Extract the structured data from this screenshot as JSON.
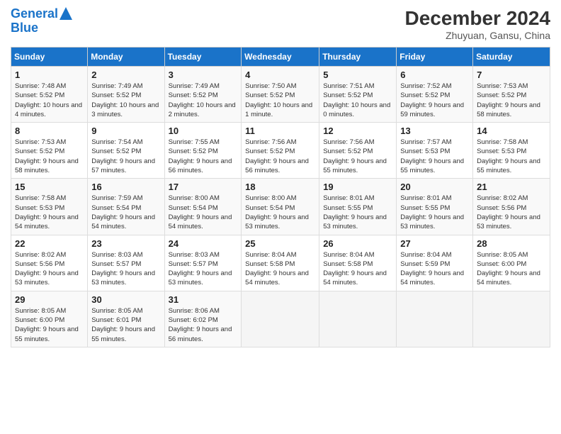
{
  "header": {
    "logo_line1": "General",
    "logo_line2": "Blue",
    "month": "December 2024",
    "location": "Zhuyuan, Gansu, China"
  },
  "weekdays": [
    "Sunday",
    "Monday",
    "Tuesday",
    "Wednesday",
    "Thursday",
    "Friday",
    "Saturday"
  ],
  "weeks": [
    [
      {
        "day": "1",
        "sunrise": "7:48 AM",
        "sunset": "5:52 PM",
        "daylight": "10 hours and 4 minutes."
      },
      {
        "day": "2",
        "sunrise": "7:49 AM",
        "sunset": "5:52 PM",
        "daylight": "10 hours and 3 minutes."
      },
      {
        "day": "3",
        "sunrise": "7:49 AM",
        "sunset": "5:52 PM",
        "daylight": "10 hours and 2 minutes."
      },
      {
        "day": "4",
        "sunrise": "7:50 AM",
        "sunset": "5:52 PM",
        "daylight": "10 hours and 1 minute."
      },
      {
        "day": "5",
        "sunrise": "7:51 AM",
        "sunset": "5:52 PM",
        "daylight": "10 hours and 0 minutes."
      },
      {
        "day": "6",
        "sunrise": "7:52 AM",
        "sunset": "5:52 PM",
        "daylight": "9 hours and 59 minutes."
      },
      {
        "day": "7",
        "sunrise": "7:53 AM",
        "sunset": "5:52 PM",
        "daylight": "9 hours and 58 minutes."
      }
    ],
    [
      {
        "day": "8",
        "sunrise": "7:53 AM",
        "sunset": "5:52 PM",
        "daylight": "9 hours and 58 minutes."
      },
      {
        "day": "9",
        "sunrise": "7:54 AM",
        "sunset": "5:52 PM",
        "daylight": "9 hours and 57 minutes."
      },
      {
        "day": "10",
        "sunrise": "7:55 AM",
        "sunset": "5:52 PM",
        "daylight": "9 hours and 56 minutes."
      },
      {
        "day": "11",
        "sunrise": "7:56 AM",
        "sunset": "5:52 PM",
        "daylight": "9 hours and 56 minutes."
      },
      {
        "day": "12",
        "sunrise": "7:56 AM",
        "sunset": "5:52 PM",
        "daylight": "9 hours and 55 minutes."
      },
      {
        "day": "13",
        "sunrise": "7:57 AM",
        "sunset": "5:53 PM",
        "daylight": "9 hours and 55 minutes."
      },
      {
        "day": "14",
        "sunrise": "7:58 AM",
        "sunset": "5:53 PM",
        "daylight": "9 hours and 55 minutes."
      }
    ],
    [
      {
        "day": "15",
        "sunrise": "7:58 AM",
        "sunset": "5:53 PM",
        "daylight": "9 hours and 54 minutes."
      },
      {
        "day": "16",
        "sunrise": "7:59 AM",
        "sunset": "5:54 PM",
        "daylight": "9 hours and 54 minutes."
      },
      {
        "day": "17",
        "sunrise": "8:00 AM",
        "sunset": "5:54 PM",
        "daylight": "9 hours and 54 minutes."
      },
      {
        "day": "18",
        "sunrise": "8:00 AM",
        "sunset": "5:54 PM",
        "daylight": "9 hours and 53 minutes."
      },
      {
        "day": "19",
        "sunrise": "8:01 AM",
        "sunset": "5:55 PM",
        "daylight": "9 hours and 53 minutes."
      },
      {
        "day": "20",
        "sunrise": "8:01 AM",
        "sunset": "5:55 PM",
        "daylight": "9 hours and 53 minutes."
      },
      {
        "day": "21",
        "sunrise": "8:02 AM",
        "sunset": "5:56 PM",
        "daylight": "9 hours and 53 minutes."
      }
    ],
    [
      {
        "day": "22",
        "sunrise": "8:02 AM",
        "sunset": "5:56 PM",
        "daylight": "9 hours and 53 minutes."
      },
      {
        "day": "23",
        "sunrise": "8:03 AM",
        "sunset": "5:57 PM",
        "daylight": "9 hours and 53 minutes."
      },
      {
        "day": "24",
        "sunrise": "8:03 AM",
        "sunset": "5:57 PM",
        "daylight": "9 hours and 53 minutes."
      },
      {
        "day": "25",
        "sunrise": "8:04 AM",
        "sunset": "5:58 PM",
        "daylight": "9 hours and 54 minutes."
      },
      {
        "day": "26",
        "sunrise": "8:04 AM",
        "sunset": "5:58 PM",
        "daylight": "9 hours and 54 minutes."
      },
      {
        "day": "27",
        "sunrise": "8:04 AM",
        "sunset": "5:59 PM",
        "daylight": "9 hours and 54 minutes."
      },
      {
        "day": "28",
        "sunrise": "8:05 AM",
        "sunset": "6:00 PM",
        "daylight": "9 hours and 54 minutes."
      }
    ],
    [
      {
        "day": "29",
        "sunrise": "8:05 AM",
        "sunset": "6:00 PM",
        "daylight": "9 hours and 55 minutes."
      },
      {
        "day": "30",
        "sunrise": "8:05 AM",
        "sunset": "6:01 PM",
        "daylight": "9 hours and 55 minutes."
      },
      {
        "day": "31",
        "sunrise": "8:06 AM",
        "sunset": "6:02 PM",
        "daylight": "9 hours and 56 minutes."
      },
      null,
      null,
      null,
      null
    ]
  ]
}
